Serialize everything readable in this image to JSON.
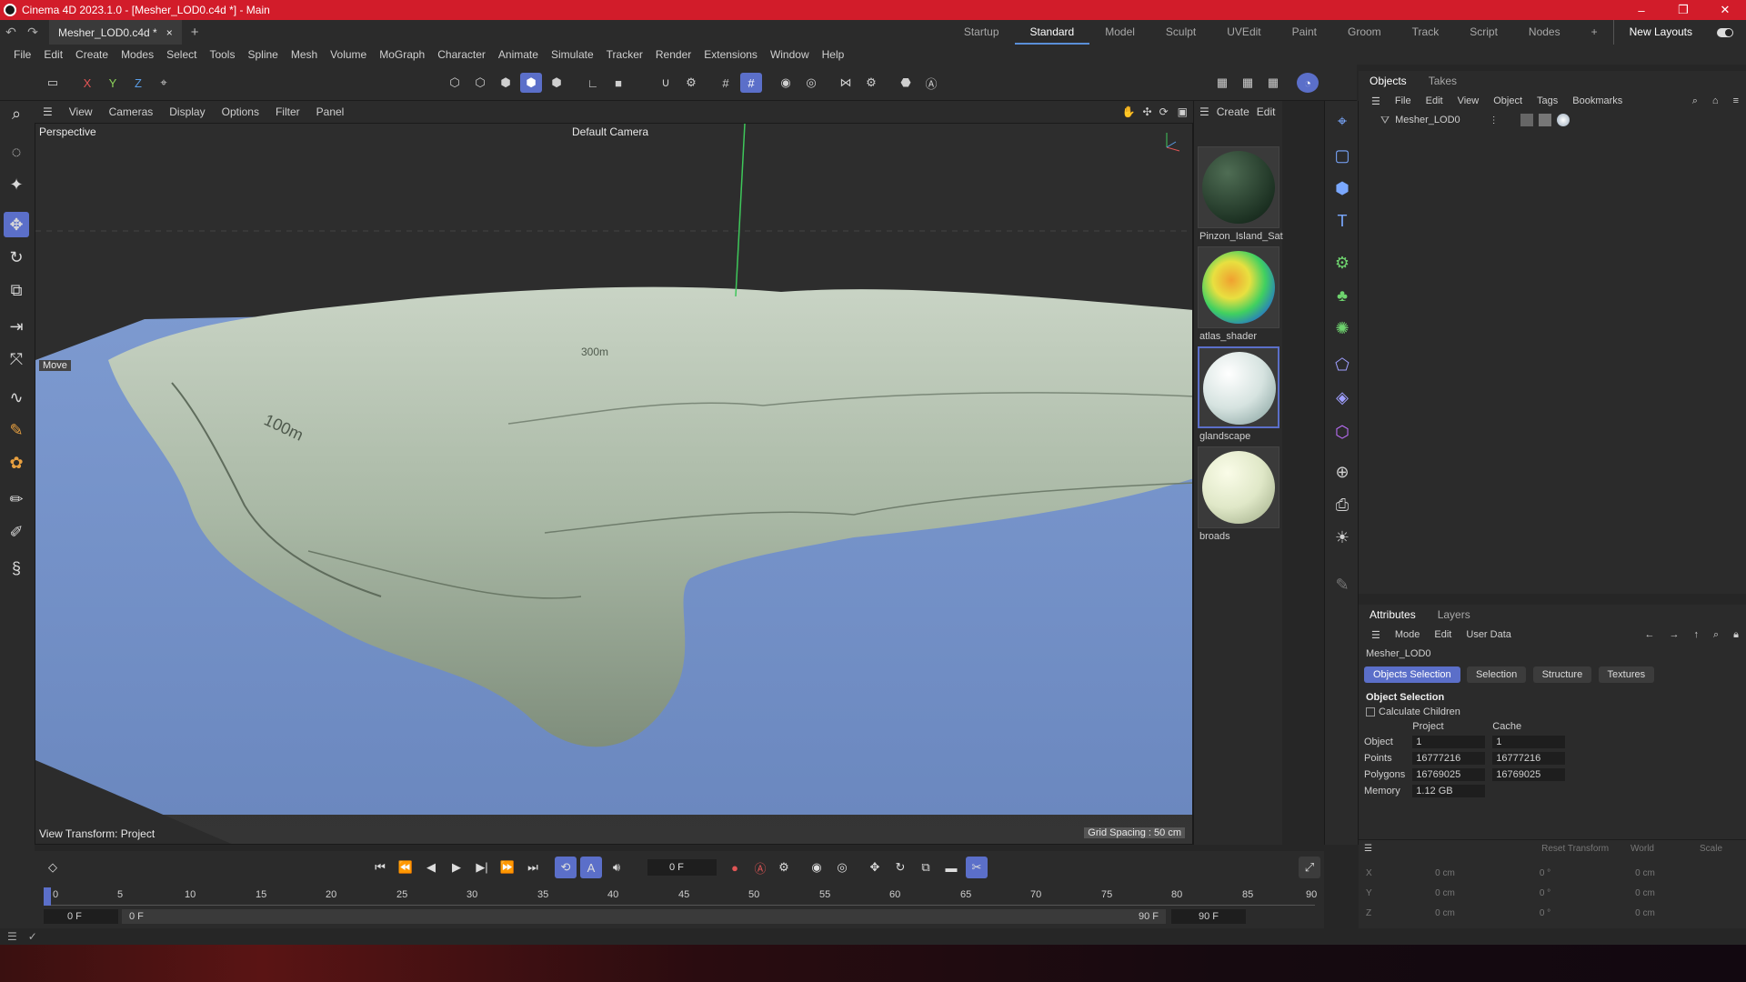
{
  "window": {
    "title": "Cinema 4D 2023.1.0 - [Mesher_LOD0.c4d *] - Main"
  },
  "tabs": {
    "doc": "Mesher_LOD0.c4d *",
    "close": "×",
    "add": "+"
  },
  "layouts": {
    "items": [
      "Startup",
      "Standard",
      "Model",
      "Sculpt",
      "UVEdit",
      "Paint",
      "Groom",
      "Track",
      "Script",
      "Nodes"
    ],
    "active": "Standard",
    "new_layouts": "New Layouts"
  },
  "menu": {
    "items": [
      "File",
      "Edit",
      "Create",
      "Modes",
      "Select",
      "Tools",
      "Spline",
      "Mesh",
      "Volume",
      "MoGraph",
      "Character",
      "Animate",
      "Simulate",
      "Tracker",
      "Render",
      "Extensions",
      "Window",
      "Help"
    ]
  },
  "viewport": {
    "menu": [
      "View",
      "Cameras",
      "Display",
      "Options",
      "Filter",
      "Panel"
    ],
    "label": "Perspective",
    "camera": "Default Camera",
    "move_label": "Move",
    "view_transform": "View Transform: Project",
    "grid_spacing": "Grid Spacing : 50 cm",
    "contour_labels": [
      "100m",
      "300m"
    ]
  },
  "materials": {
    "menu": [
      "Create",
      "Edit"
    ],
    "items": [
      {
        "name": "Pinzon_Island_Sat"
      },
      {
        "name": "atlas_shader"
      },
      {
        "name": "glandscape"
      },
      {
        "name": "broads"
      }
    ]
  },
  "objects": {
    "tabs": [
      "Objects",
      "Takes"
    ],
    "menu": [
      "File",
      "Edit",
      "View",
      "Object",
      "Tags",
      "Bookmarks"
    ],
    "item": "Mesher_LOD0"
  },
  "attributes": {
    "tabs": [
      "Attributes",
      "Layers"
    ],
    "menu": [
      "Mode",
      "Edit",
      "User Data"
    ],
    "object_name": "Mesher_LOD0",
    "buttons": [
      "Objects Selection",
      "Selection",
      "Structure",
      "Textures"
    ],
    "section": "Object Selection",
    "checkbox": "Calculate Children",
    "col_project": "Project",
    "col_cache": "Cache",
    "rows": [
      {
        "label": "Object",
        "project": "1",
        "cache": "1"
      },
      {
        "label": "Points",
        "project": "16777216",
        "cache": "16777216"
      },
      {
        "label": "Polygons",
        "project": "16769025",
        "cache": "16769025"
      },
      {
        "label": "Memory",
        "project": "1.12 GB",
        "cache": ""
      }
    ],
    "transform": {
      "reset": "Reset Transform",
      "space": "World",
      "mode": "Scale",
      "rows": [
        {
          "axis": "X",
          "pos": "0 cm",
          "rot": "0 °",
          "scale": "0 cm"
        },
        {
          "axis": "Y",
          "pos": "0 cm",
          "rot": "0 °",
          "scale": "0 cm"
        },
        {
          "axis": "Z",
          "pos": "0 cm",
          "rot": "0 °",
          "scale": "0 cm"
        }
      ]
    }
  },
  "timeline": {
    "current": "0 F",
    "ticks": [
      "0",
      "5",
      "10",
      "15",
      "20",
      "25",
      "30",
      "35",
      "40",
      "45",
      "50",
      "55",
      "60",
      "65",
      "70",
      "75",
      "80",
      "85",
      "90"
    ],
    "start": "0 F",
    "range_start": "0 F",
    "range_end": "90 F",
    "end": "90 F"
  }
}
